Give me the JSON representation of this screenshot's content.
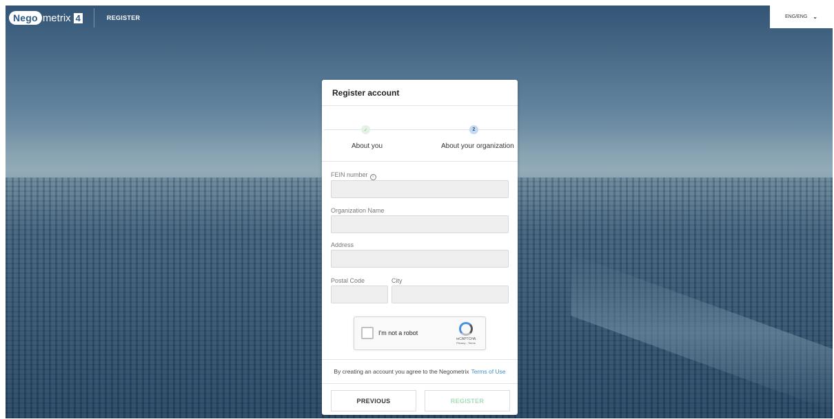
{
  "topbar": {
    "logo_nego": "Nego",
    "logo_metrix": "metrix",
    "logo_version": "4",
    "nav_register": "REGISTER",
    "language": "ENG/ENG"
  },
  "card": {
    "title": "Register account",
    "steps": [
      {
        "label": "About you",
        "marker": "✓",
        "state": "done"
      },
      {
        "label": "About your organization",
        "marker": "2",
        "state": "active"
      }
    ],
    "fields": {
      "fein_label": "FEIN number",
      "org_label": "Organization Name",
      "address_label": "Address",
      "postal_label": "Postal Code",
      "city_label": "City"
    },
    "captcha": {
      "label": "I'm not a robot",
      "brand": "reCAPTCHA",
      "links": "Privacy - Terms"
    },
    "terms": {
      "text": "By creating an account you agree to the Negometrix",
      "link": "Terms of Use"
    },
    "buttons": {
      "previous": "PREVIOUS",
      "register": "REGISTER"
    }
  },
  "colors": {
    "brand": "#2e5a85",
    "link": "#3d8fc4",
    "register_disabled": "#a6dcb6"
  }
}
